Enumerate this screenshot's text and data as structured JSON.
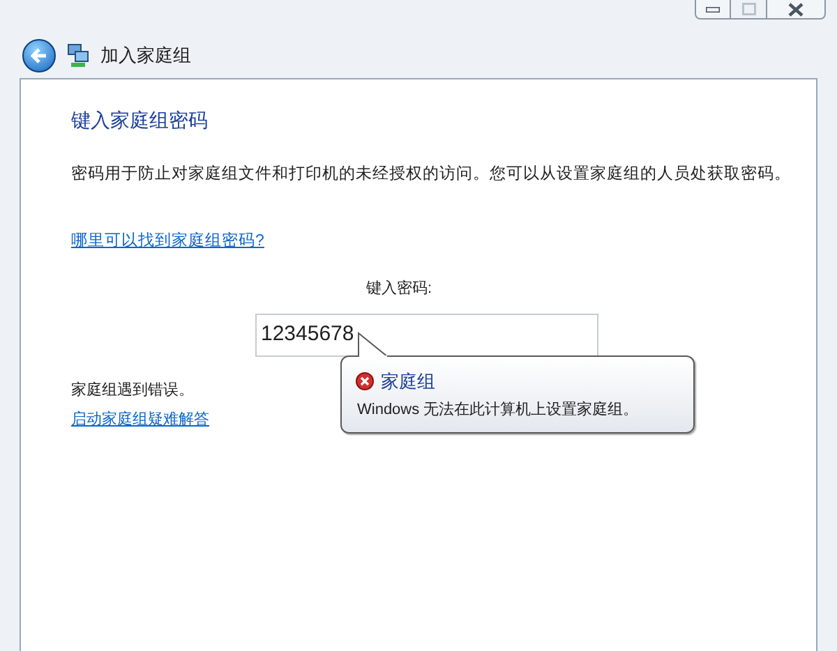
{
  "window": {
    "title": "加入家庭组",
    "controls": [
      {
        "kind": "minimize",
        "disabled": false
      },
      {
        "kind": "maximize",
        "disabled": true
      },
      {
        "kind": "close",
        "disabled": false
      }
    ]
  },
  "heading": "键入家庭组密码",
  "description": "密码用于防止对家庭组文件和打印机的未经授权的访问。您可以从设置家庭组的人员处获取密码。",
  "help_link": "哪里可以找到家庭组密码?",
  "password": {
    "label": "键入密码:",
    "value": "12345678"
  },
  "error_balloon": {
    "title": "家庭组",
    "message": "Windows 无法在此计算机上设置家庭组。"
  },
  "error_text": "家庭组遇到错误。",
  "troubleshoot_link": "启动家庭组疑难解答"
}
